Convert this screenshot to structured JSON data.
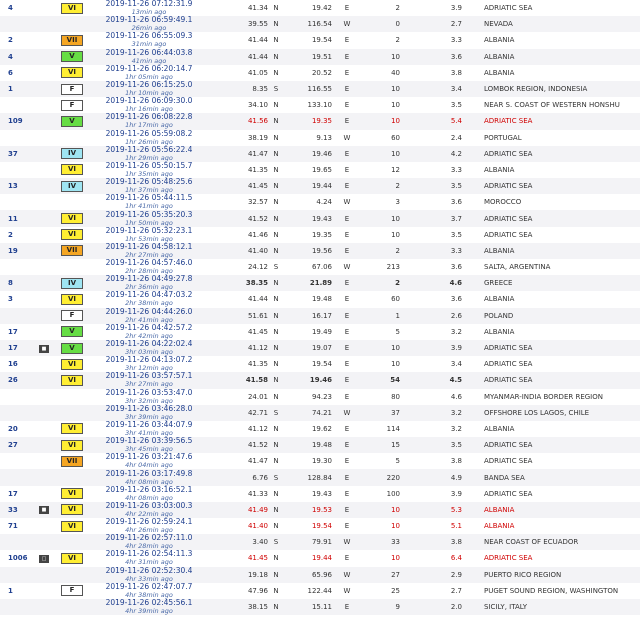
{
  "colors": {
    "F": "#ffffff",
    "IV": "#9fe5f2",
    "V": "#66dd44",
    "VI": "#ffee33",
    "VII": "#f5a623",
    "link": "#1f3f8f",
    "alert": "#d00000"
  },
  "rows": [
    {
      "felt": "4",
      "icon": "",
      "intensity": "VI",
      "date": "2019-11-26   07:12:31.9",
      "ago": "13min ago",
      "lat": "41.34",
      "ns": "N",
      "lon": "19.42",
      "ew": "E",
      "depth": "2",
      "mag": "3.9",
      "region": "ADRIATIC SEA",
      "style": ""
    },
    {
      "felt": "",
      "icon": "",
      "intensity": "",
      "date": "2019-11-26   06:59:49.1",
      "ago": "26min ago",
      "lat": "39.55",
      "ns": "N",
      "lon": "116.54",
      "ew": "W",
      "depth": "0",
      "mag": "2.7",
      "region": "NEVADA",
      "style": ""
    },
    {
      "felt": "2",
      "icon": "",
      "intensity": "VII",
      "date": "2019-11-26   06:55:09.3",
      "ago": "31min ago",
      "lat": "41.44",
      "ns": "N",
      "lon": "19.54",
      "ew": "E",
      "depth": "2",
      "mag": "3.3",
      "region": "ALBANIA",
      "style": ""
    },
    {
      "felt": "4",
      "icon": "",
      "intensity": "V",
      "date": "2019-11-26   06:44:03.8",
      "ago": "41min ago",
      "lat": "41.44",
      "ns": "N",
      "lon": "19.51",
      "ew": "E",
      "depth": "10",
      "mag": "3.6",
      "region": "ALBANIA",
      "style": ""
    },
    {
      "felt": "6",
      "icon": "",
      "intensity": "VI",
      "date": "2019-11-26   06:20:14.7",
      "ago": "1hr 05min ago",
      "lat": "41.05",
      "ns": "N",
      "lon": "20.52",
      "ew": "E",
      "depth": "40",
      "mag": "3.8",
      "region": "ALBANIA",
      "style": ""
    },
    {
      "felt": "1",
      "icon": "",
      "intensity": "F",
      "date": "2019-11-26   06:15:25.0",
      "ago": "1hr 10min ago",
      "lat": "8.35",
      "ns": "S",
      "lon": "116.55",
      "ew": "E",
      "depth": "10",
      "mag": "3.4",
      "region": "LOMBOK REGION, INDONESIA",
      "style": ""
    },
    {
      "felt": "",
      "icon": "",
      "intensity": "F",
      "date": "2019-11-26   06:09:30.0",
      "ago": "1hr 16min ago",
      "lat": "34.10",
      "ns": "N",
      "lon": "133.10",
      "ew": "E",
      "depth": "10",
      "mag": "3.5",
      "region": "NEAR S. COAST OF WESTERN HONSHU",
      "style": ""
    },
    {
      "felt": "109",
      "icon": "",
      "intensity": "V",
      "date": "2019-11-26   06:08:22.8",
      "ago": "1hr 17min ago",
      "lat": "41.56",
      "ns": "N",
      "lon": "19.35",
      "ew": "E",
      "depth": "10",
      "mag": "5.4",
      "region": "ADRIATIC SEA",
      "style": "red"
    },
    {
      "felt": "",
      "icon": "",
      "intensity": "",
      "date": "2019-11-26   05:59:08.2",
      "ago": "1hr 26min ago",
      "lat": "38.19",
      "ns": "N",
      "lon": "9.13",
      "ew": "W",
      "depth": "60",
      "mag": "2.4",
      "region": "PORTUGAL",
      "style": ""
    },
    {
      "felt": "37",
      "icon": "",
      "intensity": "IV",
      "date": "2019-11-26   05:56:22.4",
      "ago": "1hr 29min ago",
      "lat": "41.47",
      "ns": "N",
      "lon": "19.46",
      "ew": "E",
      "depth": "10",
      "mag": "4.2",
      "region": "ADRIATIC SEA",
      "style": ""
    },
    {
      "felt": "",
      "icon": "",
      "intensity": "VI",
      "date": "2019-11-26   05:50:15.7",
      "ago": "1hr 35min ago",
      "lat": "41.35",
      "ns": "N",
      "lon": "19.65",
      "ew": "E",
      "depth": "12",
      "mag": "3.3",
      "region": "ALBANIA",
      "style": ""
    },
    {
      "felt": "13",
      "icon": "",
      "intensity": "IV",
      "date": "2019-11-26   05:48:25.6",
      "ago": "1hr 37min ago",
      "lat": "41.45",
      "ns": "N",
      "lon": "19.44",
      "ew": "E",
      "depth": "2",
      "mag": "3.5",
      "region": "ADRIATIC SEA",
      "style": ""
    },
    {
      "felt": "",
      "icon": "",
      "intensity": "",
      "date": "2019-11-26   05:44:11.5",
      "ago": "1hr 41min ago",
      "lat": "32.57",
      "ns": "N",
      "lon": "4.24",
      "ew": "W",
      "depth": "3",
      "mag": "3.6",
      "region": "MOROCCO",
      "style": ""
    },
    {
      "felt": "11",
      "icon": "",
      "intensity": "VI",
      "date": "2019-11-26   05:35:20.3",
      "ago": "1hr 50min ago",
      "lat": "41.52",
      "ns": "N",
      "lon": "19.43",
      "ew": "E",
      "depth": "10",
      "mag": "3.7",
      "region": "ADRIATIC SEA",
      "style": ""
    },
    {
      "felt": "2",
      "icon": "",
      "intensity": "VI",
      "date": "2019-11-26   05:32:23.1",
      "ago": "1hr 53min ago",
      "lat": "41.46",
      "ns": "N",
      "lon": "19.35",
      "ew": "E",
      "depth": "10",
      "mag": "3.5",
      "region": "ADRIATIC SEA",
      "style": ""
    },
    {
      "felt": "19",
      "icon": "",
      "intensity": "VII",
      "date": "2019-11-26   04:58:12.1",
      "ago": "2hr 27min ago",
      "lat": "41.40",
      "ns": "N",
      "lon": "19.56",
      "ew": "E",
      "depth": "2",
      "mag": "3.3",
      "region": "ALBANIA",
      "style": ""
    },
    {
      "felt": "",
      "icon": "",
      "intensity": "",
      "date": "2019-11-26   04:57:46.0",
      "ago": "2hr 28min ago",
      "lat": "24.12",
      "ns": "S",
      "lon": "67.06",
      "ew": "W",
      "depth": "213",
      "mag": "3.6",
      "region": "SALTA, ARGENTINA",
      "style": ""
    },
    {
      "felt": "8",
      "icon": "",
      "intensity": "IV",
      "date": "2019-11-26   04:49:27.8",
      "ago": "2hr 36min ago",
      "lat": "38.35",
      "ns": "N",
      "lon": "21.89",
      "ew": "E",
      "depth": "2",
      "mag": "4.6",
      "region": "GREECE",
      "style": "major"
    },
    {
      "felt": "3",
      "icon": "",
      "intensity": "VI",
      "date": "2019-11-26   04:47:03.2",
      "ago": "2hr 38min ago",
      "lat": "41.44",
      "ns": "N",
      "lon": "19.48",
      "ew": "E",
      "depth": "60",
      "mag": "3.6",
      "region": "ALBANIA",
      "style": ""
    },
    {
      "felt": "",
      "icon": "",
      "intensity": "F",
      "date": "2019-11-26   04:44:26.0",
      "ago": "2hr 41min ago",
      "lat": "51.61",
      "ns": "N",
      "lon": "16.17",
      "ew": "E",
      "depth": "1",
      "mag": "2.6",
      "region": "POLAND",
      "style": ""
    },
    {
      "felt": "17",
      "icon": "",
      "intensity": "V",
      "date": "2019-11-26   04:42:57.2",
      "ago": "2hr 42min ago",
      "lat": "41.45",
      "ns": "N",
      "lon": "19.49",
      "ew": "E",
      "depth": "5",
      "mag": "3.2",
      "region": "ALBANIA",
      "style": ""
    },
    {
      "felt": "17",
      "icon": "cam",
      "intensity": "V",
      "date": "2019-11-26   04:22:02.4",
      "ago": "3hr 03min ago",
      "lat": "41.12",
      "ns": "N",
      "lon": "19.07",
      "ew": "E",
      "depth": "10",
      "mag": "3.9",
      "region": "ADRIATIC SEA",
      "style": ""
    },
    {
      "felt": "16",
      "icon": "",
      "intensity": "VI",
      "date": "2019-11-26   04:13:07.2",
      "ago": "3hr 12min ago",
      "lat": "41.35",
      "ns": "N",
      "lon": "19.54",
      "ew": "E",
      "depth": "10",
      "mag": "3.4",
      "region": "ADRIATIC SEA",
      "style": ""
    },
    {
      "felt": "26",
      "icon": "",
      "intensity": "VI",
      "date": "2019-11-26   03:57:57.1",
      "ago": "3hr 27min ago",
      "lat": "41.58",
      "ns": "N",
      "lon": "19.46",
      "ew": "E",
      "depth": "54",
      "mag": "4.5",
      "region": "ADRIATIC SEA",
      "style": "major"
    },
    {
      "felt": "",
      "icon": "",
      "intensity": "",
      "date": "2019-11-26   03:53:47.0",
      "ago": "3hr 32min ago",
      "lat": "24.01",
      "ns": "N",
      "lon": "94.23",
      "ew": "E",
      "depth": "80",
      "mag": "4.6",
      "region": "MYANMAR-INDIA BORDER REGION",
      "style": ""
    },
    {
      "felt": "",
      "icon": "",
      "intensity": "",
      "date": "2019-11-26   03:46:28.0",
      "ago": "3hr 39min ago",
      "lat": "42.71",
      "ns": "S",
      "lon": "74.21",
      "ew": "W",
      "depth": "37",
      "mag": "3.2",
      "region": "OFFSHORE LOS LAGOS, CHILE",
      "style": ""
    },
    {
      "felt": "20",
      "icon": "",
      "intensity": "VI",
      "date": "2019-11-26   03:44:07.9",
      "ago": "3hr 41min ago",
      "lat": "41.12",
      "ns": "N",
      "lon": "19.62",
      "ew": "E",
      "depth": "114",
      "mag": "3.2",
      "region": "ALBANIA",
      "style": ""
    },
    {
      "felt": "27",
      "icon": "",
      "intensity": "VI",
      "date": "2019-11-26   03:39:56.5",
      "ago": "3hr 45min ago",
      "lat": "41.52",
      "ns": "N",
      "lon": "19.48",
      "ew": "E",
      "depth": "15",
      "mag": "3.5",
      "region": "ADRIATIC SEA",
      "style": ""
    },
    {
      "felt": "",
      "icon": "",
      "intensity": "VII",
      "date": "2019-11-26   03:21:47.6",
      "ago": "4hr 04min ago",
      "lat": "41.47",
      "ns": "N",
      "lon": "19.30",
      "ew": "E",
      "depth": "5",
      "mag": "3.8",
      "region": "ADRIATIC SEA",
      "style": ""
    },
    {
      "felt": "",
      "icon": "",
      "intensity": "",
      "date": "2019-11-26   03:17:49.8",
      "ago": "4hr 08min ago",
      "lat": "6.76",
      "ns": "S",
      "lon": "128.84",
      "ew": "E",
      "depth": "220",
      "mag": "4.9",
      "region": "BANDA SEA",
      "style": ""
    },
    {
      "felt": "17",
      "icon": "",
      "intensity": "VI",
      "date": "2019-11-26   03:16:52.1",
      "ago": "4hr 08min ago",
      "lat": "41.33",
      "ns": "N",
      "lon": "19.43",
      "ew": "E",
      "depth": "100",
      "mag": "3.9",
      "region": "ADRIATIC SEA",
      "style": ""
    },
    {
      "felt": "33",
      "icon": "cam",
      "intensity": "VI",
      "date": "2019-11-26   03:03:00.3",
      "ago": "4hr 22min ago",
      "lat": "41.49",
      "ns": "N",
      "lon": "19.53",
      "ew": "E",
      "depth": "10",
      "mag": "5.3",
      "region": "ALBANIA",
      "style": "red"
    },
    {
      "felt": "71",
      "icon": "",
      "intensity": "VI",
      "date": "2019-11-26   02:59:24.1",
      "ago": "4hr 26min ago",
      "lat": "41.40",
      "ns": "N",
      "lon": "19.54",
      "ew": "E",
      "depth": "10",
      "mag": "5.1",
      "region": "ALBANIA",
      "style": "red"
    },
    {
      "felt": "",
      "icon": "",
      "intensity": "",
      "date": "2019-11-26   02:57:11.0",
      "ago": "4hr 28min ago",
      "lat": "3.40",
      "ns": "S",
      "lon": "79.91",
      "ew": "W",
      "depth": "33",
      "mag": "3.8",
      "region": "NEAR COAST OF ECUADOR",
      "style": ""
    },
    {
      "felt": "1006",
      "icon": "doc",
      "intensity": "VI",
      "date": "2019-11-26   02:54:11.3",
      "ago": "4hr 31min ago",
      "lat": "41.45",
      "ns": "N",
      "lon": "19.44",
      "ew": "E",
      "depth": "10",
      "mag": "6.4",
      "region": "ADRIATIC SEA",
      "style": "red"
    },
    {
      "felt": "",
      "icon": "",
      "intensity": "",
      "date": "2019-11-26   02:52:30.4",
      "ago": "4hr 33min ago",
      "lat": "19.18",
      "ns": "N",
      "lon": "65.96",
      "ew": "W",
      "depth": "27",
      "mag": "2.9",
      "region": "PUERTO RICO REGION",
      "style": ""
    },
    {
      "felt": "1",
      "icon": "",
      "intensity": "F",
      "date": "2019-11-26   02:47:07.7",
      "ago": "4hr 38min ago",
      "lat": "47.96",
      "ns": "N",
      "lon": "122.44",
      "ew": "W",
      "depth": "25",
      "mag": "2.7",
      "region": "PUGET SOUND REGION, WASHINGTON",
      "style": ""
    },
    {
      "felt": "",
      "icon": "",
      "intensity": "",
      "date": "2019-11-26   02:45:56.1",
      "ago": "4hr 39min ago",
      "lat": "38.15",
      "ns": "N",
      "lon": "15.11",
      "ew": "E",
      "depth": "9",
      "mag": "2.0",
      "region": "SICILY, ITALY",
      "style": ""
    }
  ]
}
